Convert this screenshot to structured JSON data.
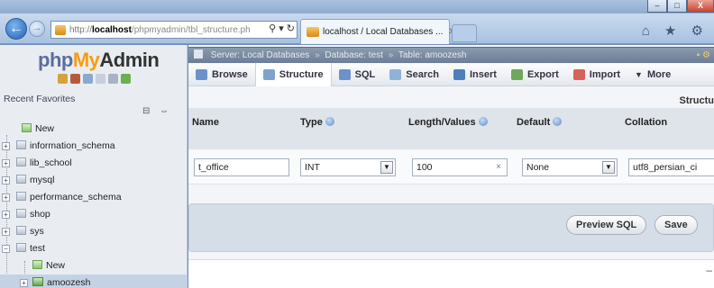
{
  "browser": {
    "address": {
      "protocol": "http://",
      "host": "localhost",
      "path": "/phpmyadmin/tbl_structure.ph",
      "icons": "⚲ ▾ ↻"
    },
    "tab": {
      "title": "localhost / Local Databases ...",
      "close": "✕"
    },
    "toolbar_icons": "⌂ ★ ⚙",
    "window_buttons": {
      "minimize": "–",
      "maximize": "□",
      "close": "X"
    }
  },
  "sidebar": {
    "logo": {
      "php": "php",
      "my": "My",
      "admin": "Admin"
    },
    "recent": "Recent",
    "favorites": "Favorites",
    "collapse_icons": "⊟ ⇔",
    "items": [
      {
        "label": "New",
        "type": "new"
      },
      {
        "label": "information_schema",
        "type": "db"
      },
      {
        "label": "lib_school",
        "type": "db"
      },
      {
        "label": "mysql",
        "type": "db"
      },
      {
        "label": "performance_schema",
        "type": "db"
      },
      {
        "label": "shop",
        "type": "db"
      },
      {
        "label": "sys",
        "type": "db"
      },
      {
        "label": "test",
        "type": "db-open"
      },
      {
        "label": "New",
        "type": "new-child"
      },
      {
        "label": "amoozesh",
        "type": "table-child"
      }
    ]
  },
  "breadcrumb": {
    "server": "Server: Local Databases",
    "database": "Database: test",
    "table": "Table: amoozesh",
    "sep": "»",
    "right_icons": "▪ ⚙"
  },
  "menu": {
    "tabs": [
      {
        "label": "Browse",
        "color": "#6b93c9"
      },
      {
        "label": "Structure",
        "color": "#7ea2cc",
        "active": true
      },
      {
        "label": "SQL",
        "color": "#6b93c9"
      },
      {
        "label": "Search",
        "color": "#8fb2da"
      },
      {
        "label": "Insert",
        "color": "#4d7fbf"
      },
      {
        "label": "Export",
        "color": "#6fa85a"
      },
      {
        "label": "Import",
        "color": "#d8615a"
      },
      {
        "label": "More",
        "color": "#555555"
      }
    ],
    "more_arrow": "▼"
  },
  "structure_label": "Structu",
  "columns": {
    "name": "Name",
    "type": "Type",
    "length": "Length/Values",
    "default": "Default",
    "collation": "Collation"
  },
  "field": {
    "name": "t_office",
    "type": "INT",
    "length": "100",
    "default": "None",
    "collation": "utf8_persian_ci",
    "arrow": "▼",
    "clear": "×"
  },
  "actions": {
    "preview": "Preview SQL",
    "save": "Save"
  },
  "scroll_hint": "–"
}
